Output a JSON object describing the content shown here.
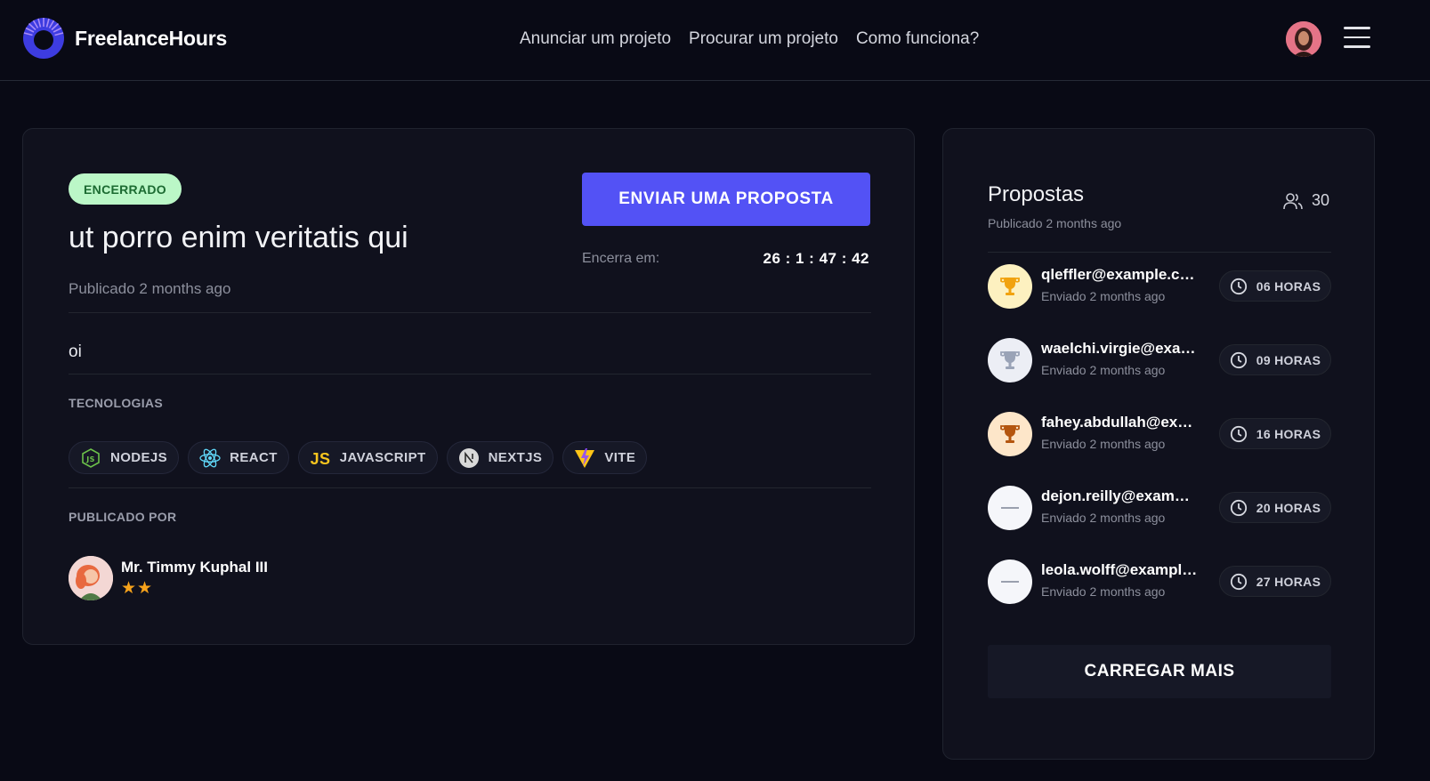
{
  "header": {
    "brand": "FreelanceHours",
    "nav": [
      "Anunciar um projeto",
      "Procurar um projeto",
      "Como funciona?"
    ]
  },
  "project": {
    "status": "ENCERRADO",
    "title": "ut porro enim veritatis qui",
    "published": "Publicado 2 months ago",
    "propose_button": "ENVIAR UMA PROPOSTA",
    "deadline_label": "Encerra em:",
    "deadline_value": "26 : 1 : 47 : 42",
    "description": "oi",
    "technologies_label": "TECNOLOGIAS",
    "technologies": [
      {
        "name": "NODEJS",
        "icon": "nodejs-icon",
        "color": "#6cc24a"
      },
      {
        "name": "REACT",
        "icon": "react-icon",
        "color": "#61dafb"
      },
      {
        "name": "JAVASCRIPT",
        "icon": "javascript-icon",
        "color": "#f7df1e"
      },
      {
        "name": "NEXTJS",
        "icon": "nextjs-icon",
        "color": "#d9d9d9"
      },
      {
        "name": "VITE",
        "icon": "vite-icon",
        "color": "#ffc517"
      }
    ],
    "published_by_label": "PUBLICADO POR",
    "author": {
      "name": "Mr. Timmy Kuphal III",
      "stars": "★★",
      "rating": 2
    }
  },
  "proposals": {
    "title": "Propostas",
    "published": "Publicado 2 months ago",
    "count": "30",
    "items": [
      {
        "email": "qleffler@example.com",
        "sent": "Enviado 2 months ago",
        "hours": "06 HORAS",
        "badge": "gold-trophy-icon",
        "bg": "#fdf1c0",
        "color": "#f1a20e"
      },
      {
        "email": "waelchi.virgie@example.com",
        "sent": "Enviado 2 months ago",
        "hours": "09 HORAS",
        "badge": "silver-trophy-icon",
        "bg": "#eceef5",
        "color": "#9aa3b7"
      },
      {
        "email": "fahey.abdullah@example.com",
        "sent": "Enviado 2 months ago",
        "hours": "16 HORAS",
        "badge": "bronze-trophy-icon",
        "bg": "#fde6c9",
        "color": "#b4560f"
      },
      {
        "email": "dejon.reilly@example.com",
        "sent": "Enviado 2 months ago",
        "hours": "20 HORAS",
        "badge": "dash-icon",
        "bg": "#f5f6fa",
        "color": "#9aa0ae"
      },
      {
        "email": "leola.wolff@example.com",
        "sent": "Enviado 2 months ago",
        "hours": "27 HORAS",
        "badge": "dash-icon",
        "bg": "#f5f6fa",
        "color": "#9aa0ae"
      }
    ],
    "load_more": "CARREGAR MAIS"
  }
}
